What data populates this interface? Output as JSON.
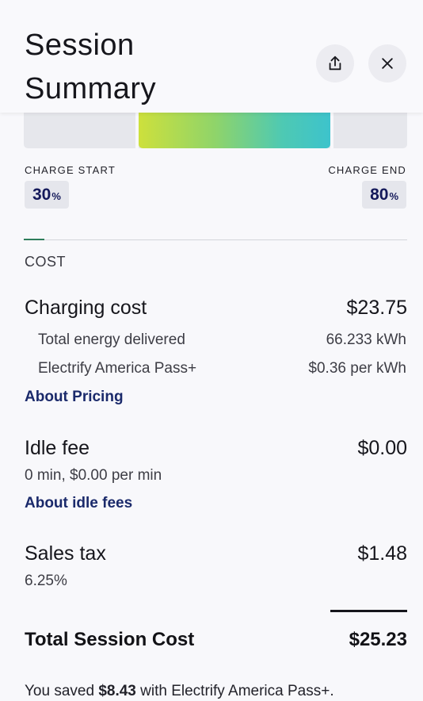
{
  "header": {
    "title_line1": "Session",
    "title_line2": "Summary"
  },
  "charge": {
    "start_label": "CHARGE START",
    "start_value": "30",
    "end_label": "CHARGE END",
    "end_value": "80",
    "percent_symbol": "%",
    "bar_start_fraction": 0.3,
    "bar_end_fraction": 0.8
  },
  "cost": {
    "section_label": "COST",
    "charging": {
      "label": "Charging cost",
      "amount": "$23.75",
      "energy_label": "Total energy delivered",
      "energy_value": "66.233 kWh",
      "plan_label": "Electrify America Pass+",
      "plan_rate": "$0.36 per kWh",
      "link": "About Pricing"
    },
    "idle": {
      "label": "Idle fee",
      "amount": "$0.00",
      "detail": "0 min, $0.00 per min",
      "link": "About idle fees"
    },
    "tax": {
      "label": "Sales tax",
      "amount": "$1.48",
      "rate": "6.25%"
    },
    "total": {
      "label": "Total Session Cost",
      "amount": "$25.23"
    },
    "savings": {
      "prefix": "You saved ",
      "amount": "$8.43",
      "suffix": " with Electrify America Pass+."
    }
  },
  "icons": {
    "share": "share-icon",
    "close": "close-icon"
  },
  "colors": {
    "link": "#1b2a6b",
    "badge_text": "#14195a",
    "gradient_start": "#cde03c",
    "gradient_end": "#3dc3cc"
  }
}
